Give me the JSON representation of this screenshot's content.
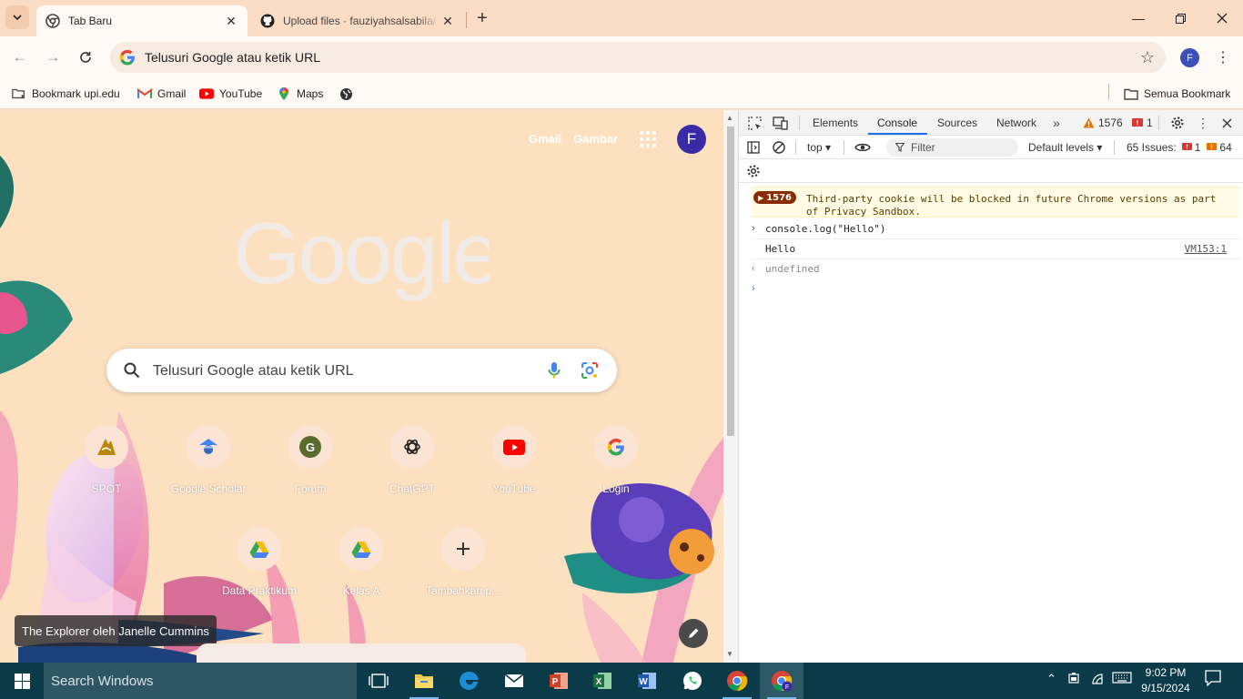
{
  "browser": {
    "tabs": [
      {
        "title": "Tab Baru",
        "active": true
      },
      {
        "title": "Upload files · fauziyahsalsabila/",
        "active": false
      }
    ],
    "omnibox_placeholder": "Telusuri Google atau ketik URL",
    "profile_initial": "F"
  },
  "bookmarks": {
    "items": [
      {
        "label": "Bookmark upi.edu",
        "icon": "bookmark-folder-icon"
      },
      {
        "label": "Gmail",
        "icon": "gmail-icon"
      },
      {
        "label": "YouTube",
        "icon": "youtube-icon"
      },
      {
        "label": "Maps",
        "icon": "maps-icon"
      },
      {
        "label": "",
        "icon": "globe-icon"
      }
    ],
    "all_bookmarks": "Semua Bookmark"
  },
  "ntp": {
    "links": {
      "gmail": "Gmail",
      "images": "Gambar"
    },
    "avatar_initial": "F",
    "search_placeholder": "Telusuri Google atau ketik URL",
    "shortcuts": [
      {
        "label": "SPOT",
        "icon": "spot-icon"
      },
      {
        "label": "Google Scholar",
        "icon": "scholar-icon"
      },
      {
        "label": "Forum",
        "icon": "forum-icon"
      },
      {
        "label": "ChatGPT",
        "icon": "chatgpt-icon"
      },
      {
        "label": "YouTube",
        "icon": "youtube-icon"
      },
      {
        "label": "Login",
        "icon": "google-icon"
      },
      {
        "label": "Data Praktikum",
        "icon": "drive-icon"
      },
      {
        "label": "Kelas A",
        "icon": "drive-icon"
      },
      {
        "label": "Tambahkan p...",
        "icon": "plus-icon"
      }
    ],
    "attribution": "The Explorer oleh Janelle Cummins"
  },
  "devtools": {
    "tabs": [
      "Elements",
      "Console",
      "Sources",
      "Network"
    ],
    "active_tab": "Console",
    "warning_count": "1576",
    "error_count": "1",
    "context": "top",
    "filter_placeholder": "Filter",
    "levels": "Default levels",
    "issues_label": "65 Issues:",
    "issues_errors": "1",
    "issues_warnings": "64",
    "console": {
      "warning_badge": "1576",
      "warning_text": "Third-party cookie will be blocked in future Chrome versions as part of Privacy Sandbox.",
      "input": "console.log(\"Hello\")",
      "output": "Hello",
      "output_source": "VM153:1",
      "return_value": "undefined"
    }
  },
  "taskbar": {
    "search_placeholder": "Search Windows",
    "time": "9:02 PM",
    "date": "9/15/2024"
  }
}
